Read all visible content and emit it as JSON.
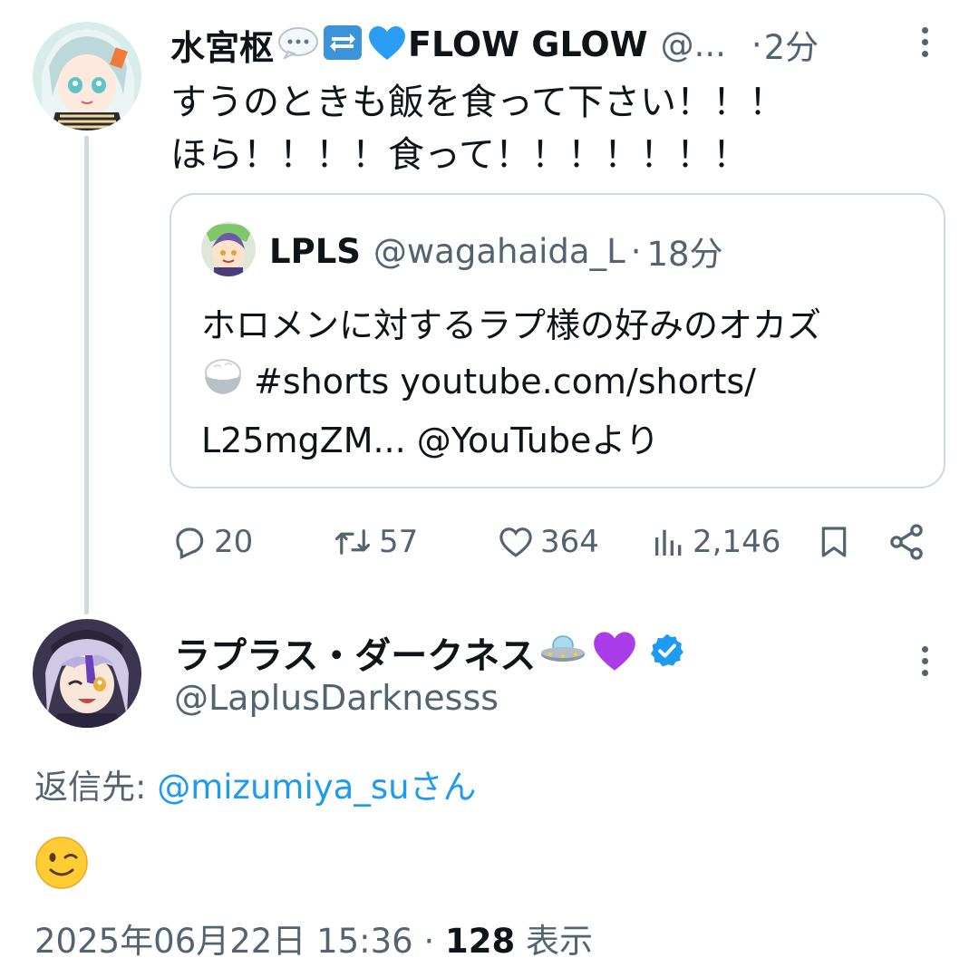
{
  "tweet": {
    "author": {
      "display_name": "水宮枢",
      "name_suffix": "FLOW GLOW",
      "handle": "@...",
      "time_sep": "·",
      "time": "2分"
    },
    "text_lines": [
      "すうのときも飯を食って下さい！！！",
      "ほら！！！！食って！！！！！！！"
    ],
    "quote": {
      "display_name": "LPLS",
      "handle": "@wagahaida_L",
      "time_sep": "·",
      "time": "18分",
      "body_lines": [
        "ホロメンに対するラプ様の好みのオカズ",
        "#shorts youtube.com/shorts/",
        "L25mgZM... @YouTubeより"
      ]
    },
    "actions": {
      "reply_count": "20",
      "retweet_count": "57",
      "like_count": "364",
      "view_count": "2,146"
    }
  },
  "reply": {
    "display_name": "ラプラス・ダークネス",
    "handle": "@LaplusDarknesss",
    "reply_to_label": "返信先: ",
    "reply_to_user": "@mizumiya_suさん",
    "timestamp": "2025年06月22日 15:36 · ",
    "views_count": "128",
    "views_label": " 表示"
  },
  "colors": {
    "text": "#0f1419",
    "secondary": "#536471",
    "link": "#1d9bf0",
    "border": "#cfd9de",
    "verified": "#1d9bf0"
  }
}
